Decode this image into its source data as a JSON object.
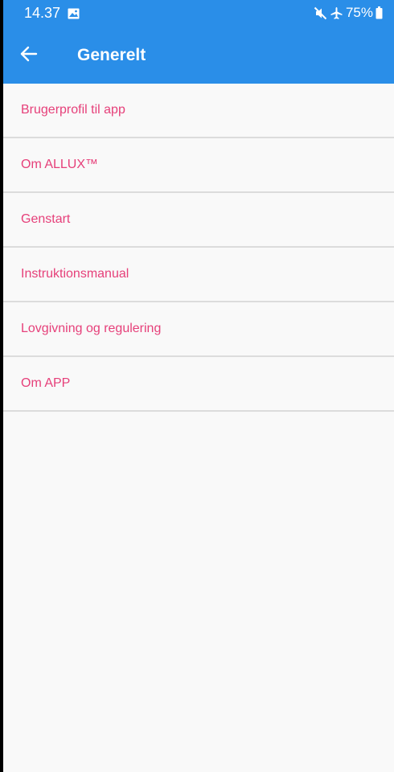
{
  "status_bar": {
    "time": "14.37",
    "battery": "75%",
    "icons": [
      "image-icon",
      "mute-icon",
      "airplane-icon",
      "battery-icon"
    ]
  },
  "app_bar": {
    "back_icon": "arrow-left-icon",
    "title": "Generelt",
    "background_color": "#2a8ee8"
  },
  "menu": {
    "accent_color": "#e6407a",
    "items": [
      {
        "label": "Brugerprofil til app"
      },
      {
        "label": "Om ALLUX™"
      },
      {
        "label": "Genstart"
      },
      {
        "label": "Instruktionsmanual"
      },
      {
        "label": "Lovgivning og regulering"
      },
      {
        "label": "Om APP"
      }
    ]
  }
}
